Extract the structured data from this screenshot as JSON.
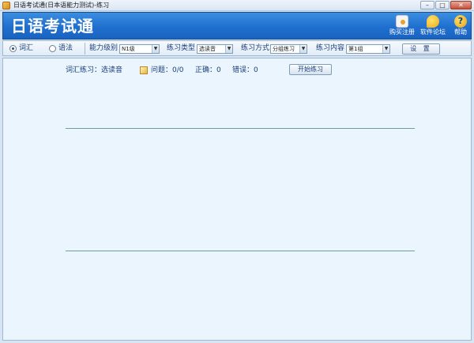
{
  "window": {
    "title": "日语考试通(日本语能力测试)-练习",
    "min_label": "–",
    "max_label": "□",
    "close_label": "✕"
  },
  "header": {
    "app_title": "日语考试通",
    "buttons": [
      {
        "label": "购买注册",
        "icon": "register-icon"
      },
      {
        "label": "软件论坛",
        "icon": "forum-bulb-icon"
      },
      {
        "label": "帮助",
        "icon": "help-icon",
        "glyph": "?"
      }
    ]
  },
  "toolbar": {
    "mode_vocab": "词汇",
    "mode_grammar": "语法",
    "selected_mode": "词汇",
    "level_label": "能力级别",
    "level_value": "N1级",
    "type_label": "练习类型",
    "type_value": "选读音",
    "method_label": "练习方式",
    "method_value": "分组练习",
    "content_label": "练习内容",
    "content_value": "第1组",
    "settings_label": "设 置"
  },
  "main": {
    "practice_label": "词汇练习：选读音",
    "question_label": "问题：0/0",
    "correct_label": "正确：0",
    "wrong_label": "错误：0",
    "start_label": "开始练习"
  },
  "colors": {
    "banner": "#1f6fcf",
    "main_bg": "#eaf5fd",
    "label_text": "#1c3f7a",
    "divider": "#6a9f9a"
  }
}
